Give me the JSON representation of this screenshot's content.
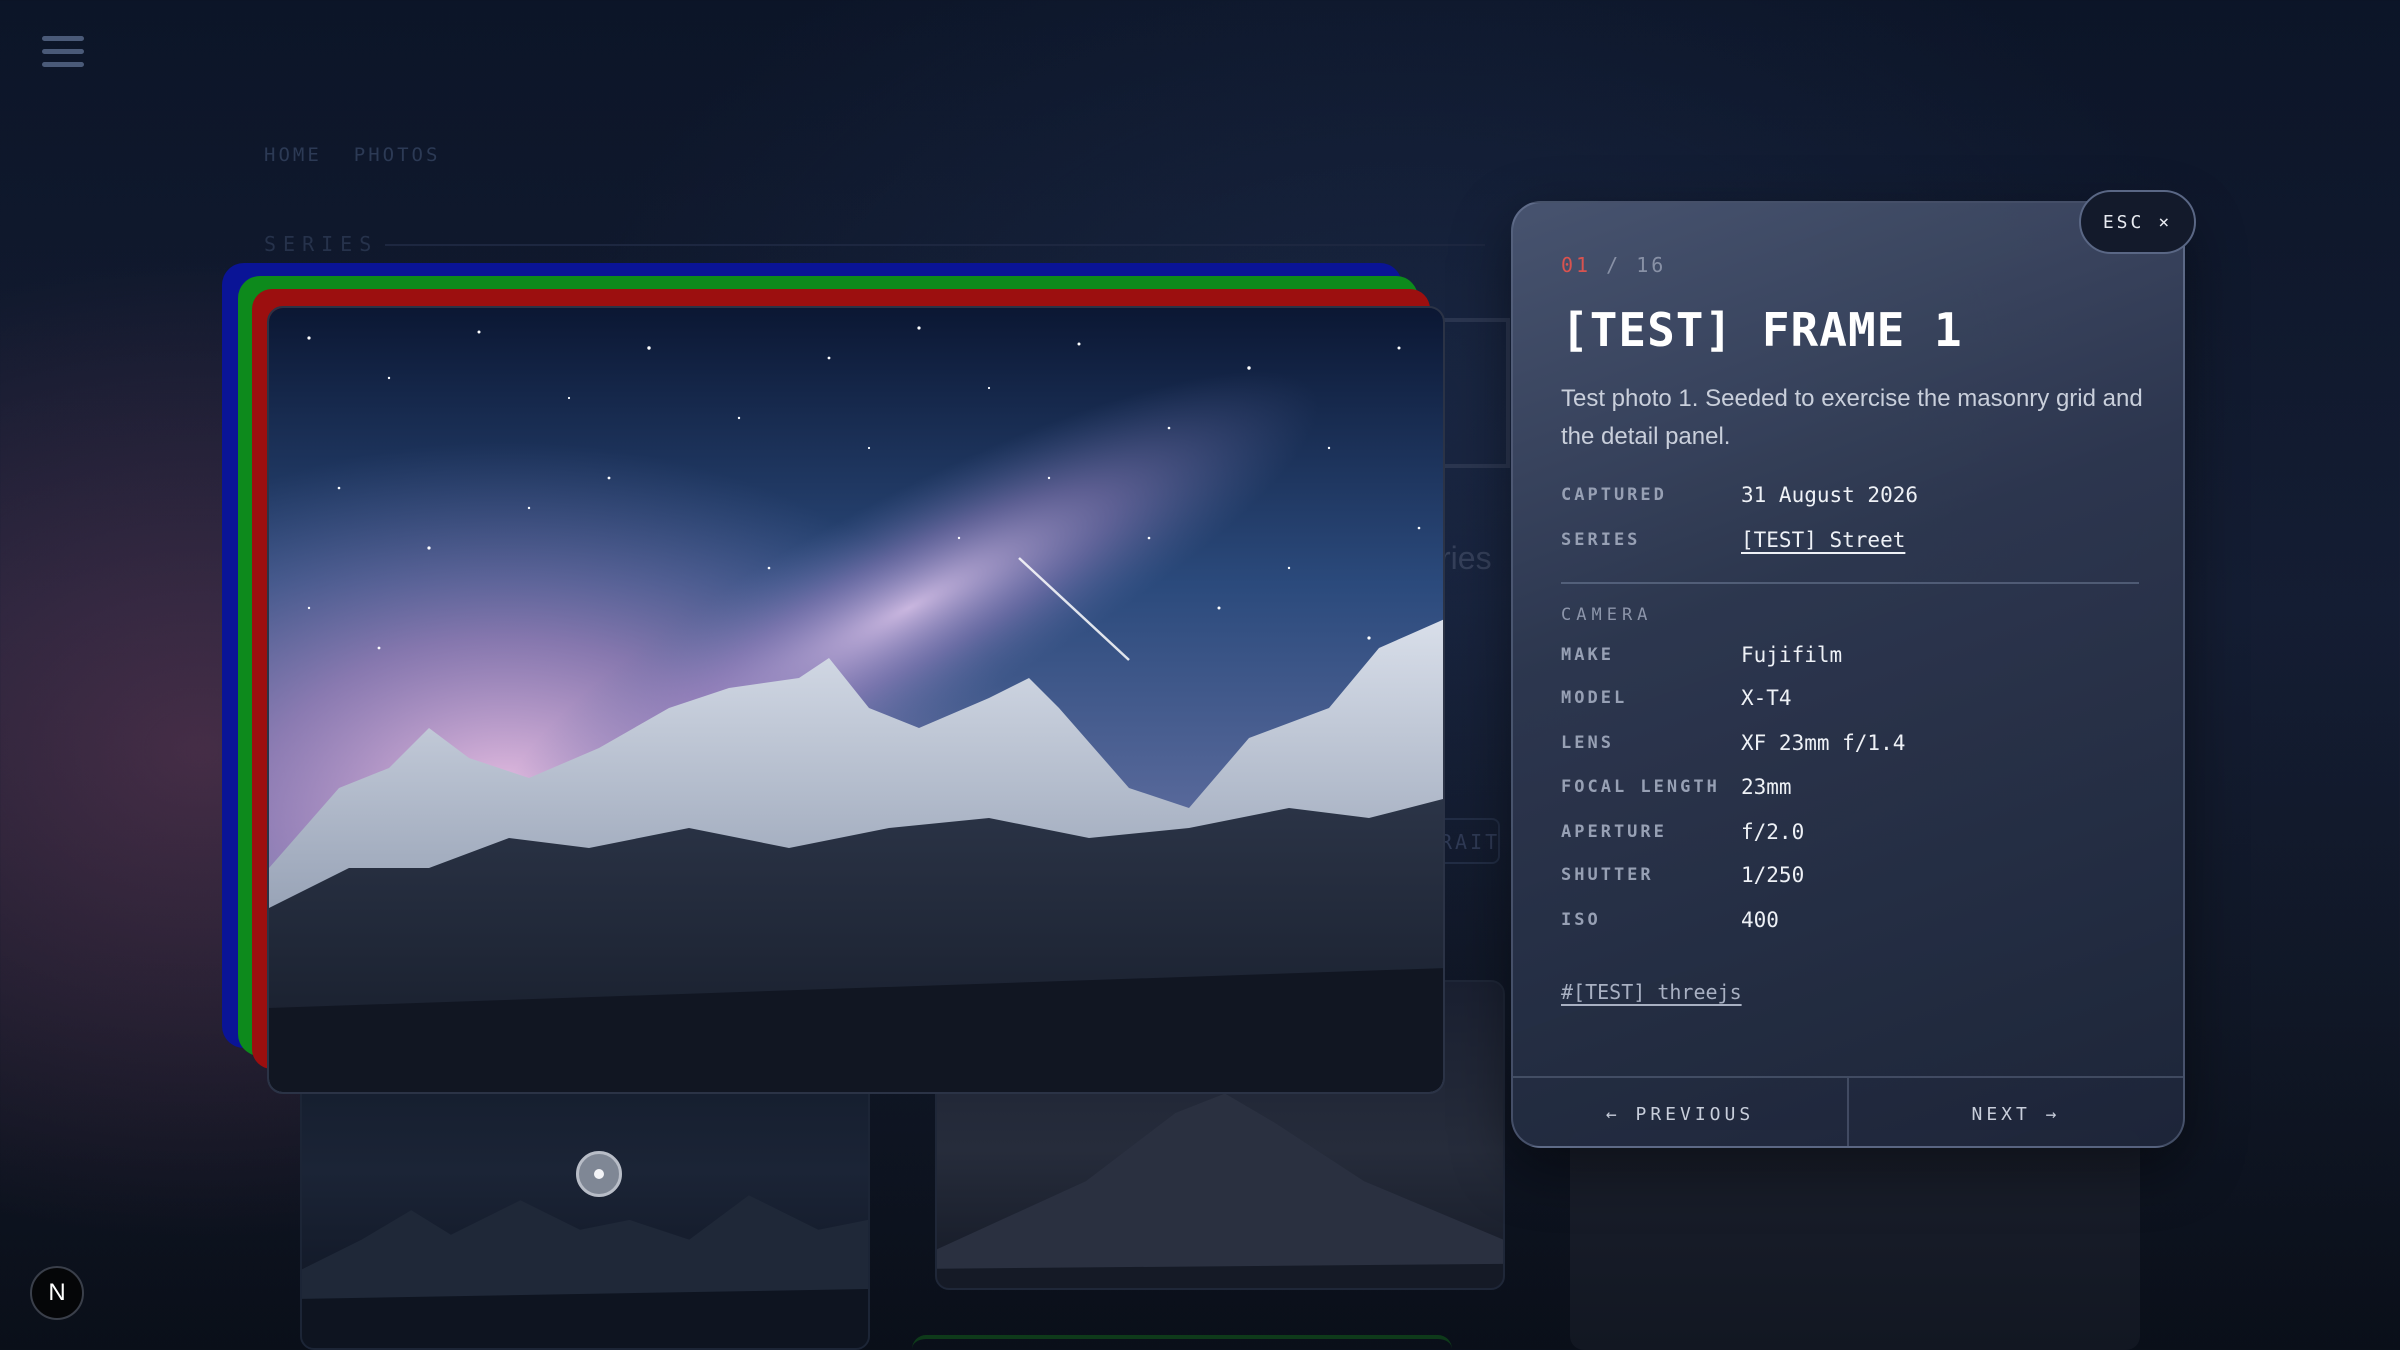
{
  "nav": {
    "breadcrumb": [
      "HOME",
      "PHOTOS"
    ],
    "series_heading": "SERIES",
    "background_sub_fragment": "ries",
    "background_pill_fragment": "RAIT"
  },
  "brand": {
    "badge": "N"
  },
  "photo": {
    "alt_icon": "starry-mountain-photo",
    "frame_colors": [
      "#0a1496",
      "#0d8a1c",
      "#9c0f0f"
    ]
  },
  "detail": {
    "esc_label": "ESC",
    "esc_icon": "×",
    "counter_current": "01",
    "counter_sep": " / ",
    "counter_total": "16",
    "title": "[TEST] FRAME 1",
    "description": "Test photo 1. Seeded to exercise the masonry grid and the detail panel.",
    "meta": [
      {
        "key": "CAPTURED",
        "value": "31 August 2026"
      },
      {
        "key": "SERIES",
        "value": "[TEST] Street"
      }
    ],
    "camera_heading": "CAMERA",
    "camera": [
      {
        "key": "MAKE",
        "value": "Fujifilm"
      },
      {
        "key": "MODEL",
        "value": "X-T4"
      },
      {
        "key": "LENS",
        "value": "XF 23mm f/1.4"
      },
      {
        "key": "FOCAL LENGTH",
        "value": "23mm"
      },
      {
        "key": "APERTURE",
        "value": "f/2.0"
      },
      {
        "key": "SHUTTER",
        "value": "1/250"
      },
      {
        "key": "ISO",
        "value": "400"
      }
    ],
    "tag": "#[TEST] threejs",
    "previous_label": "← PREVIOUS",
    "next_label": "NEXT →"
  }
}
